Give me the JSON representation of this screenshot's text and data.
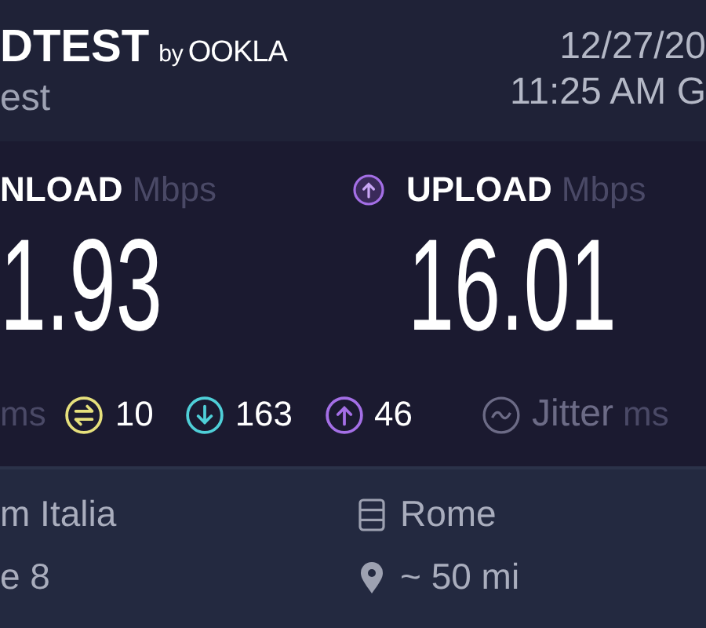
{
  "header": {
    "logo": {
      "name": "DTEST",
      "by": "by",
      "brand": "OOKLA"
    },
    "subtitle": "est",
    "date": "12/27/20",
    "time": "11:25 AM G"
  },
  "results": [
    {
      "kind": "download",
      "label": "NLOAD",
      "unit": "Mbps",
      "value": "1.93"
    },
    {
      "kind": "upload",
      "label": "UPLOAD",
      "unit": "Mbps",
      "value": "16.01"
    }
  ],
  "stats": {
    "ping_unit": "ms",
    "items": [
      {
        "kind": "idle",
        "value": "10",
        "color": "#e6e07c"
      },
      {
        "kind": "down",
        "value": "163",
        "color": "#4fcfd8"
      },
      {
        "kind": "up",
        "value": "46",
        "color": "#a46fe6"
      }
    ],
    "jitter": {
      "label": "Jitter",
      "unit": "ms"
    }
  },
  "provider": {
    "name": "m Italia",
    "line_2": "e 8"
  },
  "server": {
    "city": "Rome",
    "distance": "~ 50 mi"
  }
}
